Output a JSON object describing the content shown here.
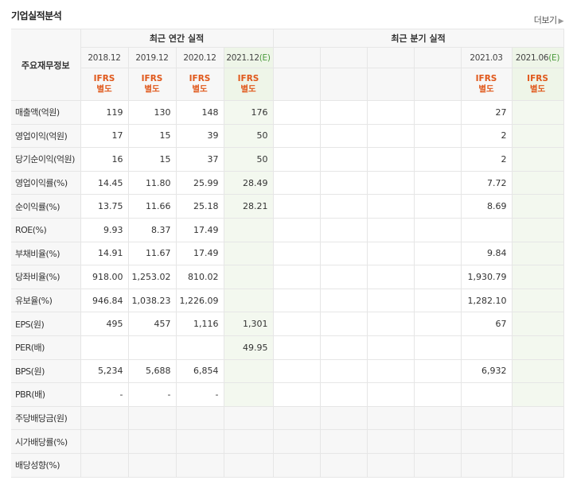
{
  "title": "기업실적분석",
  "more": "더보기",
  "header": {
    "label": "주요재무정보",
    "annual_group": "최근 연간 실적",
    "quarter_group": "최근 분기 실적",
    "annual_years": [
      "2018.12",
      "2019.12",
      "2020.12",
      "2021.12"
    ],
    "quarter_years": [
      "",
      "",
      "",
      "",
      "2021.03",
      "2021.06"
    ],
    "estimate_mark": "(E)",
    "ifrs_line1": "IFRS",
    "ifrs_line2": "별도"
  },
  "rows": [
    {
      "label": "매출액(억원)",
      "annual": [
        "119",
        "130",
        "148",
        "176"
      ],
      "quarter": [
        "",
        "",
        "",
        "",
        "27",
        ""
      ]
    },
    {
      "label": "영업이익(억원)",
      "annual": [
        "17",
        "15",
        "39",
        "50"
      ],
      "quarter": [
        "",
        "",
        "",
        "",
        "2",
        ""
      ]
    },
    {
      "label": "당기순이익(억원)",
      "annual": [
        "16",
        "15",
        "37",
        "50"
      ],
      "quarter": [
        "",
        "",
        "",
        "",
        "2",
        ""
      ]
    },
    {
      "label": "영업이익률(%)",
      "annual": [
        "14.45",
        "11.80",
        "25.99",
        "28.49"
      ],
      "quarter": [
        "",
        "",
        "",
        "",
        "7.72",
        ""
      ]
    },
    {
      "label": "순이익률(%)",
      "annual": [
        "13.75",
        "11.66",
        "25.18",
        "28.21"
      ],
      "quarter": [
        "",
        "",
        "",
        "",
        "8.69",
        ""
      ]
    },
    {
      "label": "ROE(%)",
      "annual": [
        "9.93",
        "8.37",
        "17.49",
        ""
      ],
      "quarter": [
        "",
        "",
        "",
        "",
        "",
        ""
      ]
    },
    {
      "label": "부채비율(%)",
      "annual": [
        "14.91",
        "11.67",
        "17.49",
        ""
      ],
      "quarter": [
        "",
        "",
        "",
        "",
        "9.84",
        ""
      ]
    },
    {
      "label": "당좌비율(%)",
      "annual": [
        "918.00",
        "1,253.02",
        "810.02",
        ""
      ],
      "quarter": [
        "",
        "",
        "",
        "",
        "1,930.79",
        ""
      ]
    },
    {
      "label": "유보율(%)",
      "annual": [
        "946.84",
        "1,038.23",
        "1,226.09",
        ""
      ],
      "quarter": [
        "",
        "",
        "",
        "",
        "1,282.10",
        ""
      ]
    },
    {
      "label": "EPS(원)",
      "annual": [
        "495",
        "457",
        "1,116",
        "1,301"
      ],
      "quarter": [
        "",
        "",
        "",
        "",
        "67",
        ""
      ]
    },
    {
      "label": "PER(배)",
      "annual": [
        "",
        "",
        "",
        "49.95"
      ],
      "quarter": [
        "",
        "",
        "",
        "",
        "",
        ""
      ]
    },
    {
      "label": "BPS(원)",
      "annual": [
        "5,234",
        "5,688",
        "6,854",
        ""
      ],
      "quarter": [
        "",
        "",
        "",
        "",
        "6,932",
        ""
      ]
    },
    {
      "label": "PBR(배)",
      "annual": [
        "-",
        "-",
        "-",
        ""
      ],
      "quarter": [
        "",
        "",
        "",
        "",
        "",
        ""
      ]
    },
    {
      "label": "주당배당금(원)",
      "annual": [
        "",
        "",
        "",
        ""
      ],
      "quarter": [
        "",
        "",
        "",
        "",
        "",
        ""
      ]
    },
    {
      "label": "시가배당률(%)",
      "annual": [
        "",
        "",
        "",
        ""
      ],
      "quarter": [
        "",
        "",
        "",
        "",
        "",
        ""
      ]
    },
    {
      "label": "배당성향(%)",
      "annual": [
        "",
        "",
        "",
        ""
      ],
      "quarter": [
        "",
        "",
        "",
        "",
        "",
        ""
      ]
    }
  ]
}
